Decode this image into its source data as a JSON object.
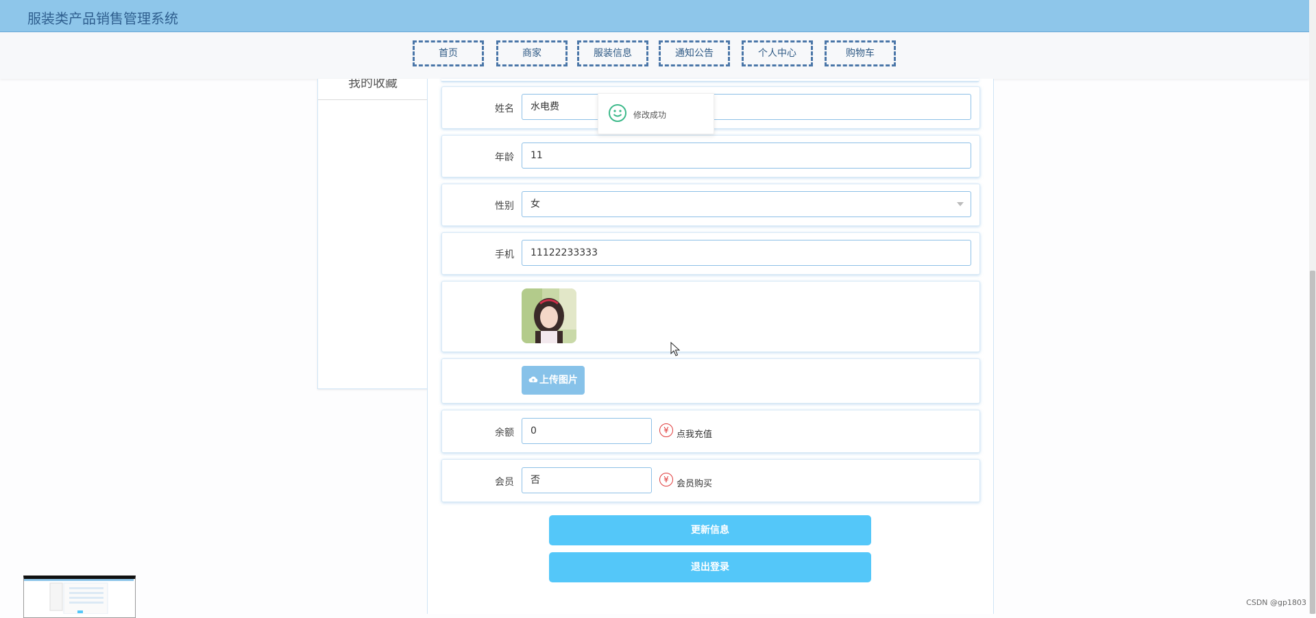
{
  "app": {
    "title": "服装类产品销售管理系统"
  },
  "nav": {
    "items": [
      {
        "label": "首页"
      },
      {
        "label": "商家"
      },
      {
        "label": "服装信息"
      },
      {
        "label": "通知公告"
      },
      {
        "label": "个人中心"
      },
      {
        "label": "购物车"
      }
    ]
  },
  "sidebar": {
    "items": [
      {
        "label": "我的收藏"
      }
    ]
  },
  "form": {
    "name": {
      "label": "姓名",
      "value": "水电费"
    },
    "age": {
      "label": "年龄",
      "value": "11"
    },
    "gender": {
      "label": "性别",
      "value": "女"
    },
    "phone": {
      "label": "手机",
      "value": "11122233333"
    },
    "upload_label": "上传图片",
    "balance": {
      "label": "余额",
      "value": "0",
      "action": "点我充值"
    },
    "member": {
      "label": "会员",
      "value": "否",
      "action": "会员购买"
    },
    "currency_symbol": "¥"
  },
  "buttons": {
    "update": "更新信息",
    "logout": "退出登录"
  },
  "toast": {
    "message": "修改成功"
  },
  "watermark": "CSDN @gp1803",
  "colors": {
    "header": "#8ec6ea",
    "button": "#54c7f9",
    "upload": "#87c2e9",
    "nav_border": "#4a76a8",
    "toast_icon": "#3cb98a",
    "currency": "#e03a3a"
  },
  "icons": [
    "smile-icon",
    "cloud-upload-icon",
    "yuan-icon",
    "cursor-icon",
    "chevron-down-icon"
  ]
}
